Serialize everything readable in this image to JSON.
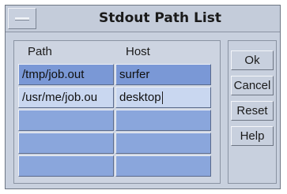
{
  "window": {
    "title": "Stdout Path List"
  },
  "table": {
    "columns": [
      "Path",
      "Host"
    ],
    "rows": [
      {
        "path": "/tmp/job.out",
        "host": "surfer"
      },
      {
        "path": "/usr/me/job.ou",
        "host": "desktop"
      },
      {
        "path": "",
        "host": ""
      },
      {
        "path": "",
        "host": ""
      },
      {
        "path": "",
        "host": ""
      }
    ]
  },
  "buttons": {
    "ok": "Ok",
    "cancel": "Cancel",
    "reset": "Reset",
    "help": "Help"
  }
}
